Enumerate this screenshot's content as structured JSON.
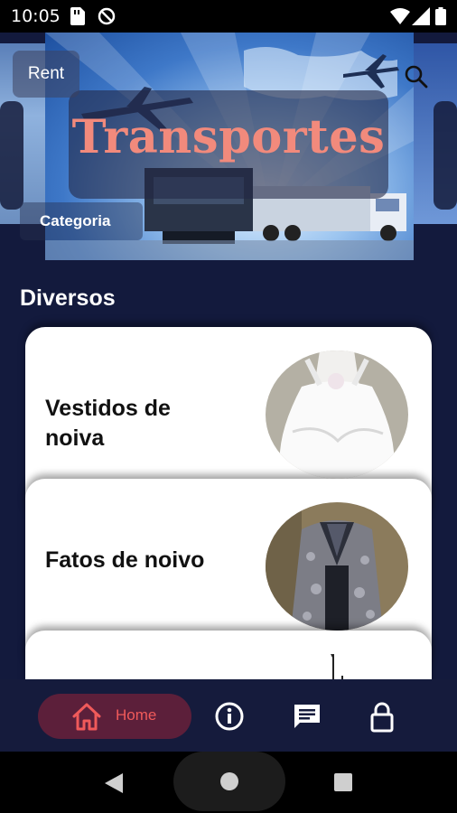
{
  "status_bar": {
    "time": "10:05"
  },
  "carousel": {
    "banner_title": "Transportes",
    "rent_label": "Rent",
    "category_label": "Categoria"
  },
  "section": {
    "title": "Diversos"
  },
  "cards": [
    {
      "label": "Vestidos de noiva"
    },
    {
      "label": "Fatos de noivo"
    },
    {
      "label": ""
    }
  ],
  "bottom_nav": {
    "home_label": "Home",
    "items": [
      "home-icon",
      "info-icon",
      "chat-icon",
      "lock-icon"
    ]
  },
  "colors": {
    "background": "#131a3d",
    "accent": "#f05a5a",
    "home_pill": "#5c1f3a",
    "banner_title": "#f28a7c"
  }
}
